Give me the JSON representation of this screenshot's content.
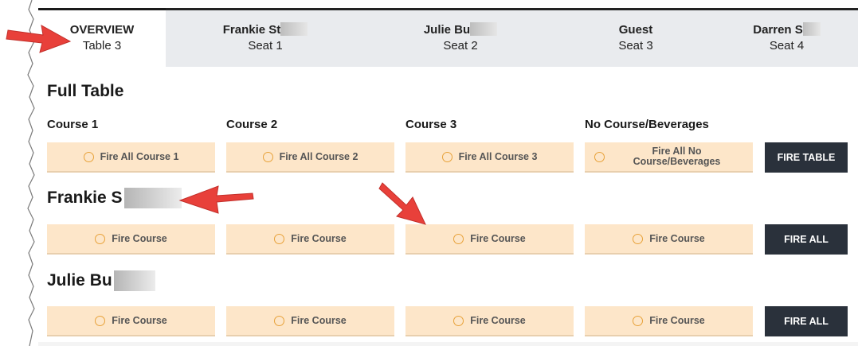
{
  "tabs": [
    {
      "name": "OVERVIEW",
      "sub": "Table 3"
    },
    {
      "name": "Frankie St",
      "sub": "Seat 1"
    },
    {
      "name": "Julie Bu",
      "sub": "Seat 2"
    },
    {
      "name": "Guest",
      "sub": "Seat 3"
    },
    {
      "name": "Darren S",
      "sub": "Seat 4"
    }
  ],
  "full_table": {
    "title": "Full Table",
    "columns": [
      "Course 1",
      "Course 2",
      "Course 3",
      "No Course/Beverages"
    ],
    "buttons": [
      "Fire All Course 1",
      "Fire All Course 2",
      "Fire All Course 3",
      "Fire All No Course/Beverages"
    ],
    "fire_table_label": "FIRE TABLE"
  },
  "seats": [
    {
      "name": "Frankie S",
      "button_label": "Fire Course",
      "fire_all_label": "FIRE ALL"
    },
    {
      "name": "Julie Bu",
      "button_label": "Fire Course",
      "fire_all_label": "FIRE ALL"
    }
  ],
  "colors": {
    "accent_bg": "#fde6c9",
    "dark_button": "#2a313b",
    "arrow": "#e8403a"
  }
}
